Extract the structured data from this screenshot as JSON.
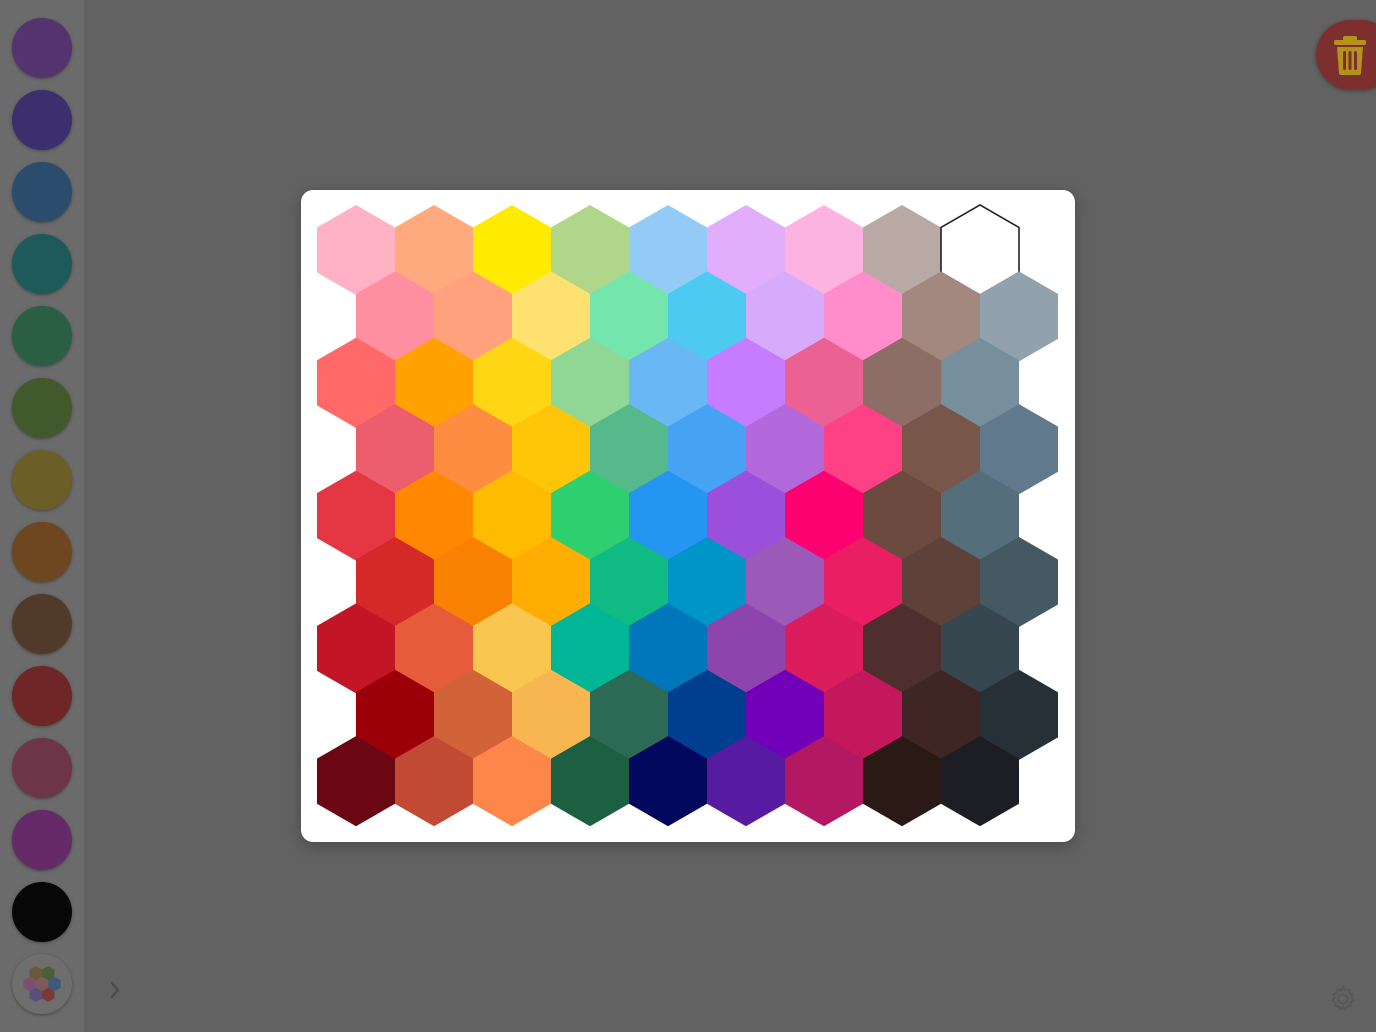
{
  "sidebar": {
    "swatches": [
      {
        "color": "#55336e",
        "label": "purple"
      },
      {
        "color": "#3c2f6e",
        "label": "indigo"
      },
      {
        "color": "#2c4c6e",
        "label": "blue"
      },
      {
        "color": "#1f5a5a",
        "label": "teal"
      },
      {
        "color": "#2a5f43",
        "label": "green"
      },
      {
        "color": "#42592c",
        "label": "olive-green"
      },
      {
        "color": "#6b5e27",
        "label": "yellow"
      },
      {
        "color": "#6e4620",
        "label": "orange"
      },
      {
        "color": "#513a2a",
        "label": "brown"
      },
      {
        "color": "#6e2626",
        "label": "red"
      },
      {
        "color": "#6e3448",
        "label": "rose"
      },
      {
        "color": "#672a68",
        "label": "magenta"
      },
      {
        "color": "#070707",
        "label": "black"
      }
    ],
    "palette_icon": "color-palette-hex-icon",
    "expand_icon": "chevron-right-icon"
  },
  "toolbar": {
    "trash_icon": "trash-icon",
    "trash_color": "#b3931c",
    "settings_icon": "gear-icon"
  },
  "picker": {
    "selected_color": "#ffffff",
    "rows": [
      [
        "#ffb2c4",
        "#ffa97e",
        "#ffeb00",
        "#b0d68a",
        "#94cbf6",
        "#e2adfb",
        "#fdb3e0",
        "#b9a9a5",
        "#ffffff"
      ],
      [
        "#ff8fa1",
        "#ffa17d",
        "#ffe16f",
        "#74e6ad",
        "#4dcaf2",
        "#d6abfc",
        "#ff8dcb",
        "#a38880",
        "#91a2ad"
      ],
      [
        "#ff6a69",
        "#ffa200",
        "#ffd613",
        "#90d694",
        "#69b7f5",
        "#c67cfc",
        "#ec6193",
        "#8d6e66",
        "#778e9b"
      ],
      [
        "#ec5d6e",
        "#ff8d41",
        "#ffc508",
        "#55b98b",
        "#46a3f4",
        "#b369db",
        "#fe4185",
        "#785649",
        "#60798c"
      ],
      [
        "#e53644",
        "#ff8800",
        "#ffbb00",
        "#2ecf6f",
        "#2495f0",
        "#9b4fdb",
        "#fe0170",
        "#6c4a40",
        "#546e7b"
      ],
      [
        "#d52828",
        "#f88102",
        "#ffac03",
        "#10ba83",
        "#0095c8",
        "#9b5ab8",
        "#e91e63",
        "#5e4138",
        "#445962"
      ],
      [
        "#c21626",
        "#e65c3b",
        "#f9c74f",
        "#00b696",
        "#0177bb",
        "#8e44ad",
        "#db1c5d",
        "#4f2f2d",
        "#37474f"
      ],
      [
        "#9b0009",
        "#d26339",
        "#f8b651",
        "#2c6a56",
        "#003f8f",
        "#7300b9",
        "#c5175c",
        "#3f2524",
        "#263137"
      ],
      [
        "#6a0713",
        "#c24a34",
        "#fd874a",
        "#1d5f41",
        "#02085e",
        "#571ba1",
        "#b31862",
        "#2a1915",
        "#1d1e23"
      ]
    ]
  }
}
